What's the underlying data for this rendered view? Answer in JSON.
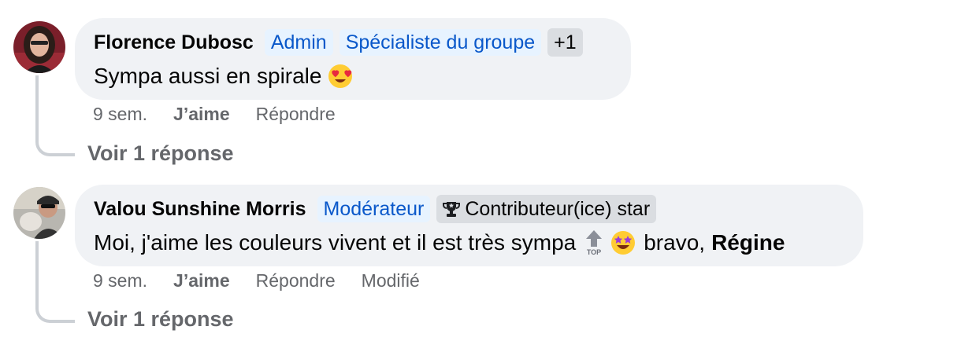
{
  "comments": [
    {
      "author": "Florence Dubosc",
      "badges": [
        "Admin",
        "Spécialiste du groupe"
      ],
      "extra_badge": "+1",
      "text": "Sympa aussi en spirale",
      "emoji": "heart-eyes-emoji",
      "time": "9 sem.",
      "like_label": "J’aime",
      "reply_label": "Répondre",
      "view_replies": "Voir 1 réponse"
    },
    {
      "author": "Valou Sunshine Morris",
      "badges": [
        "Modérateur"
      ],
      "star_badge": "Contributeur(ice) star",
      "text": "Moi, j'aime les couleurs vivent et il est très sympa",
      "after_emoji_text": "bravo,",
      "mention": "Régine",
      "emojis": [
        "top-arrow-emoji",
        "star-struck-emoji"
      ],
      "time": "9 sem.",
      "like_label": "J’aime",
      "reply_label": "Répondre",
      "edited_label": "Modifié",
      "view_replies": "Voir 1 réponse"
    }
  ],
  "colors": {
    "bubble": "#f0f2f5",
    "badge_blue_bg": "#e7f3ff",
    "badge_blue_text": "#0a58ca",
    "secondary_text": "#65676b",
    "thread_line": "#ccd0d5"
  }
}
